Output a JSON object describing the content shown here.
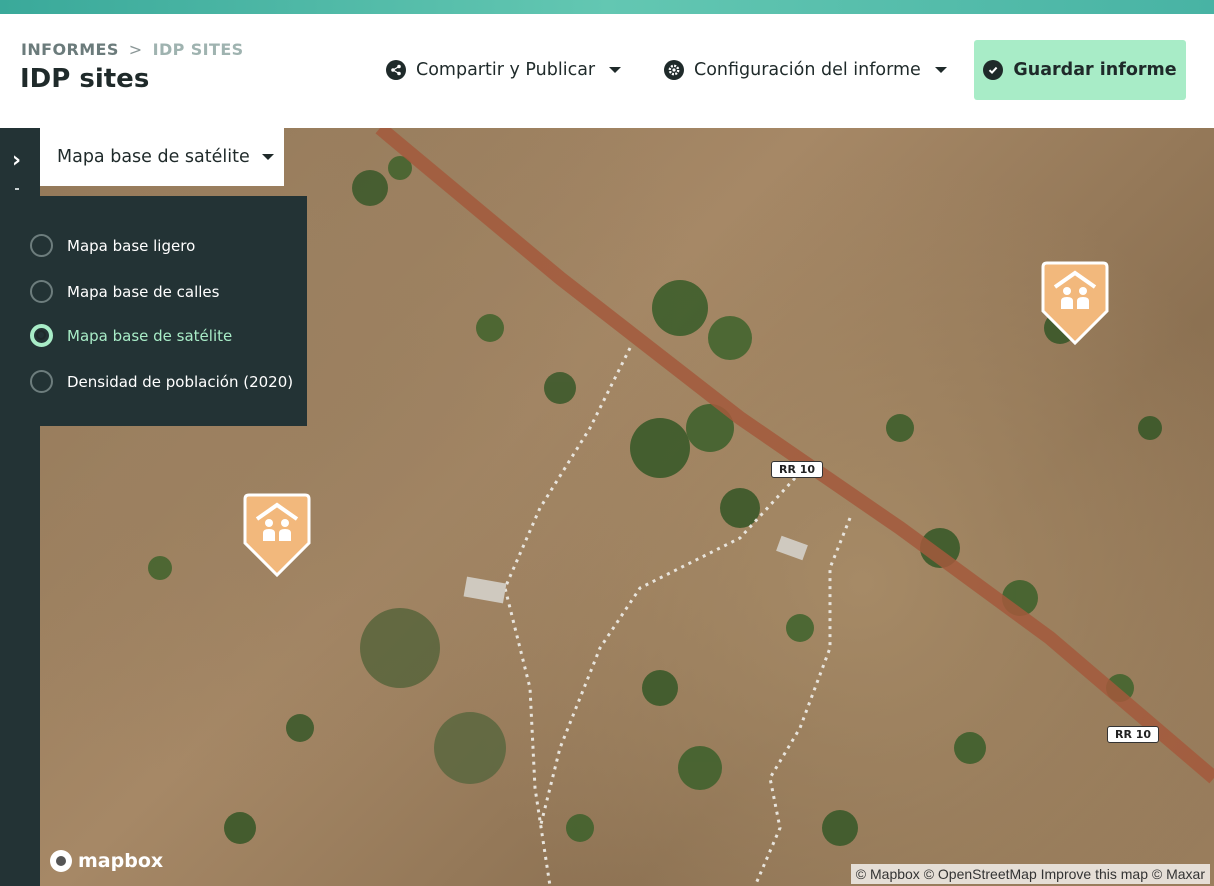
{
  "header": {
    "breadcrumb": [
      "INFORMES",
      "IDP SITES"
    ],
    "breadcrumb_separator": ">",
    "title": "IDP sites",
    "share_label": "Compartir y Publicar",
    "config_label": "Configuración del informe",
    "save_label": "Guardar informe",
    "share_icon": "share-icon",
    "config_icon": "gear-icon",
    "save_icon": "check-icon"
  },
  "sidebar": {
    "toggle_icon": "chevron-right-icon"
  },
  "basemap": {
    "selected": "Mapa base de satélite",
    "options": [
      {
        "label": "Mapa base ligero",
        "selected": false
      },
      {
        "label": "Mapa base de calles",
        "selected": false
      },
      {
        "label": "Mapa base de satélite",
        "selected": true
      },
      {
        "label": "Densidad de población (2020)",
        "selected": false
      }
    ]
  },
  "map": {
    "road_labels": [
      "RR 10",
      "RR 10"
    ],
    "logo": "mapbox",
    "attribution": "© Mapbox © OpenStreetMap Improve this map © Maxar",
    "pin_icon": "idp-shelter-icon"
  },
  "colors": {
    "accent": "#a8ecc7",
    "dark_panel": "#233335",
    "pin": "#f2b87c",
    "road": "#a3593c"
  }
}
